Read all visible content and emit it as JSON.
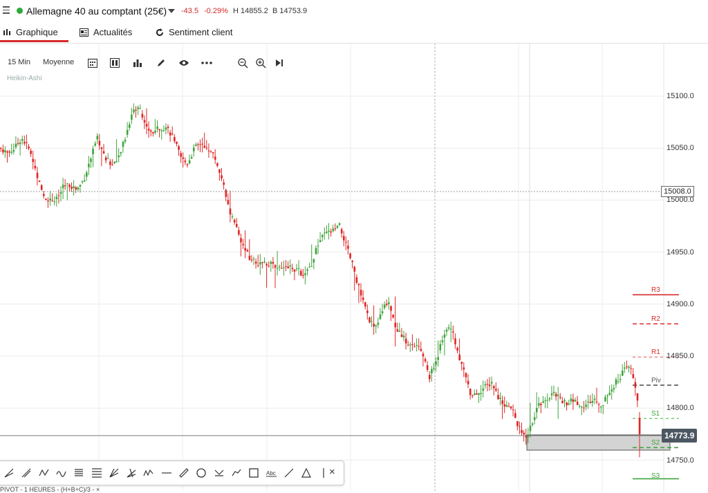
{
  "header": {
    "instrument": "Allemagne 40 au comptant (25€)",
    "change": "-43.5",
    "change_pct": "-0.29%",
    "high": "H 14855.2",
    "low": "B 14753.9"
  },
  "tabs": [
    {
      "label": "Graphique"
    },
    {
      "label": "Actualités"
    },
    {
      "label": "Sentiment client"
    }
  ],
  "toolbar": {
    "interval": "15 Min",
    "indicator": "Moyenne",
    "chart_style": "Heikin-Ashi"
  },
  "drawing_tools": [
    "fib-fan",
    "trend-line",
    "zigzag",
    "wave",
    "gann-grid",
    "fib-retracement",
    "gann-fan",
    "pitchfork",
    "elliott-wave",
    "horizontal-line",
    "ruler",
    "circle",
    "trend-angle",
    "path",
    "rectangle",
    "text",
    "ray",
    "triangle",
    "vertical-line",
    "close"
  ],
  "price_labels": {
    "current": "15008.0",
    "last": "14773.9"
  },
  "pivots": {
    "R3": "R3",
    "R2": "R2",
    "R1": "R1",
    "Piv": "Piv",
    "S1": "S1",
    "S2": "S2",
    "S3": "S3"
  },
  "colors": {
    "up": "#3ea43b",
    "down": "#e02424",
    "accent": "#d62b2b"
  },
  "bottom_text": "PIVOT - 1 HEURES - (H+B+C)/3 - ×",
  "chart_data": {
    "type": "candlestick",
    "style": "Heikin-Ashi",
    "interval": "15 Min",
    "ylim": [
      14740,
      15140
    ],
    "yticks": [
      14750.0,
      14800.0,
      14850.0,
      14900.0,
      14950.0,
      15000.0,
      15050.0,
      15100.0
    ],
    "reference_line": 15008.0,
    "last_price": 14773.9,
    "pivots": {
      "R3": 14909,
      "R2": 14881,
      "R1": 14849,
      "Piv": 14822,
      "S1": 14790,
      "S2": 14762,
      "S3": 14732
    },
    "anchors": [
      [
        0,
        15050
      ],
      [
        10,
        15045
      ],
      [
        20,
        15050
      ],
      [
        30,
        15060
      ],
      [
        40,
        15050
      ],
      [
        50,
        15030
      ],
      [
        60,
        15005
      ],
      [
        70,
        15000
      ],
      [
        80,
        15000
      ],
      [
        90,
        15012
      ],
      [
        100,
        15015
      ],
      [
        110,
        15010
      ],
      [
        120,
        15020
      ],
      [
        130,
        15040
      ],
      [
        140,
        15060
      ],
      [
        150,
        15040
      ],
      [
        160,
        15035
      ],
      [
        170,
        15040
      ],
      [
        180,
        15060
      ],
      [
        190,
        15085
      ],
      [
        200,
        15090
      ],
      [
        210,
        15070
      ],
      [
        220,
        15065
      ],
      [
        230,
        15070
      ],
      [
        240,
        15070
      ],
      [
        250,
        15060
      ],
      [
        260,
        15040
      ],
      [
        270,
        15035
      ],
      [
        280,
        15050
      ],
      [
        290,
        15055
      ],
      [
        300,
        15050
      ],
      [
        310,
        15040
      ],
      [
        320,
        15020
      ],
      [
        330,
        14990
      ],
      [
        340,
        14975
      ],
      [
        350,
        14955
      ],
      [
        360,
        14945
      ],
      [
        370,
        14940
      ],
      [
        380,
        14938
      ],
      [
        390,
        14940
      ],
      [
        400,
        14935
      ],
      [
        410,
        14933
      ],
      [
        420,
        14936
      ],
      [
        430,
        14932
      ],
      [
        440,
        14928
      ],
      [
        450,
        14940
      ],
      [
        460,
        14960
      ],
      [
        470,
        14968
      ],
      [
        480,
        14970
      ],
      [
        490,
        14975
      ],
      [
        500,
        14955
      ],
      [
        510,
        14935
      ],
      [
        520,
        14910
      ],
      [
        530,
        14890
      ],
      [
        540,
        14875
      ],
      [
        550,
        14890
      ],
      [
        560,
        14905
      ],
      [
        570,
        14880
      ],
      [
        580,
        14870
      ],
      [
        590,
        14860
      ],
      [
        600,
        14860
      ],
      [
        610,
        14852
      ],
      [
        620,
        14830
      ],
      [
        630,
        14845
      ],
      [
        640,
        14870
      ],
      [
        650,
        14880
      ],
      [
        660,
        14855
      ],
      [
        670,
        14835
      ],
      [
        680,
        14813
      ],
      [
        690,
        14815
      ],
      [
        700,
        14820
      ],
      [
        710,
        14825
      ],
      [
        720,
        14810
      ],
      [
        730,
        14803
      ],
      [
        740,
        14798
      ],
      [
        750,
        14780
      ],
      [
        760,
        14770
      ],
      [
        770,
        14790
      ],
      [
        780,
        14805
      ],
      [
        790,
        14810
      ],
      [
        800,
        14815
      ],
      [
        810,
        14808
      ],
      [
        820,
        14805
      ],
      [
        830,
        14808
      ],
      [
        840,
        14800
      ],
      [
        850,
        14805
      ],
      [
        860,
        14808
      ],
      [
        870,
        14803
      ],
      [
        880,
        14815
      ],
      [
        890,
        14825
      ],
      [
        900,
        14835
      ],
      [
        910,
        14840
      ],
      [
        920,
        14815
      ],
      [
        925,
        14765
      ]
    ]
  }
}
